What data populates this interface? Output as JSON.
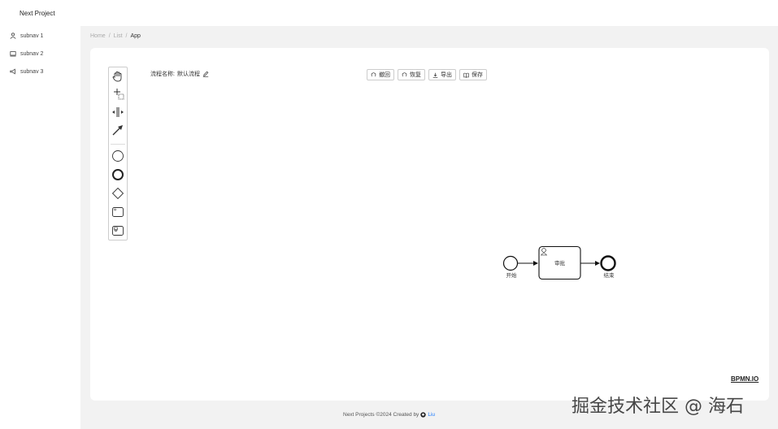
{
  "app": {
    "title": "Next Project"
  },
  "sidebar": {
    "items": [
      {
        "label": "subnav 1",
        "icon": "user-icon"
      },
      {
        "label": "subnav 2",
        "icon": "laptop-icon"
      },
      {
        "label": "subnav 3",
        "icon": "notification-icon"
      }
    ]
  },
  "breadcrumb": {
    "items": [
      "Home",
      "/",
      "List",
      "/",
      "App"
    ]
  },
  "process": {
    "name_label": "流程名称:",
    "name_value": "默认流程"
  },
  "toolbar": {
    "undo_label": "撤回",
    "redo_label": "恢复",
    "export_label": "导出",
    "save_label": "保存"
  },
  "palette": {
    "tools": [
      "hand-tool-icon",
      "lasso-tool-icon",
      "space-tool-icon",
      "connect-tool-icon",
      "start-event-icon",
      "end-event-icon",
      "gateway-icon",
      "task-icon",
      "subprocess-icon"
    ]
  },
  "diagram": {
    "start_label": "开始",
    "task_label": "审批",
    "end_label": "结束"
  },
  "bpmn_logo": "BPMN.IO",
  "footer": {
    "text": "Next Projects ©2024 Created by",
    "link": "Liu"
  },
  "watermark": "掘金技术社区 @ 海石"
}
